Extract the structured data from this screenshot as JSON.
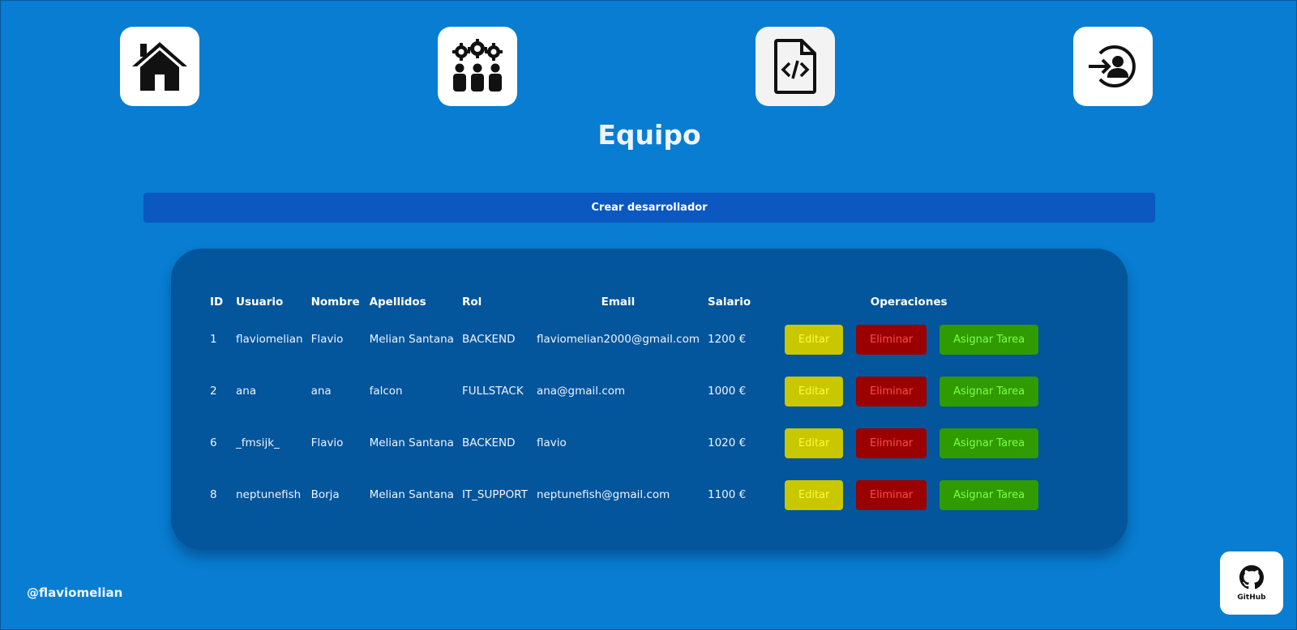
{
  "nav": {
    "items": [
      {
        "name": "home-nav-button",
        "icon": "house-icon"
      },
      {
        "name": "team-nav-button",
        "icon": "team-gears-icon"
      },
      {
        "name": "code-file-nav-button",
        "icon": "code-file-icon"
      },
      {
        "name": "login-nav-button",
        "icon": "user-login-icon"
      }
    ]
  },
  "page": {
    "title": "Equipo"
  },
  "actions": {
    "create_label": "Crear desarrollador"
  },
  "table": {
    "headers": [
      "ID",
      "Usuario",
      "Nombre",
      "Apellidos",
      "Rol",
      "Email",
      "Salario",
      "Operaciones"
    ],
    "rows": [
      {
        "id": "1",
        "usuario": "flaviomelian",
        "nombre": "Flavio",
        "apellidos": "Melian Santana",
        "rol": "BACKEND",
        "email": "flaviomelian2000@gmail.com",
        "salario": "1200 €"
      },
      {
        "id": "2",
        "usuario": "ana",
        "nombre": "ana",
        "apellidos": "falcon",
        "rol": "FULLSTACK",
        "email": "ana@gmail.com",
        "salario": "1000 €"
      },
      {
        "id": "6",
        "usuario": "_fmsijk_",
        "nombre": "Flavio",
        "apellidos": "Melian Santana",
        "rol": "BACKEND",
        "email": "flavio",
        "salario": "1020 €"
      },
      {
        "id": "8",
        "usuario": "neptunefish",
        "nombre": "Borja",
        "apellidos": "Melian Santana",
        "rol": "IT_SUPPORT",
        "email": "neptunefish@gmail.com",
        "salario": "1100 €"
      }
    ],
    "ops": {
      "edit": "Editar",
      "delete": "Eliminar",
      "assign": "Asignar Tarea"
    }
  },
  "footer": {
    "handle": "@flaviomelian",
    "github_label": "GitHub"
  },
  "colors": {
    "background": "#087dd1",
    "card": "#03559c",
    "create_button": "#0a58c0",
    "edit": "#c8c700",
    "delete": "#9b0000",
    "assign": "#2f9b00"
  }
}
